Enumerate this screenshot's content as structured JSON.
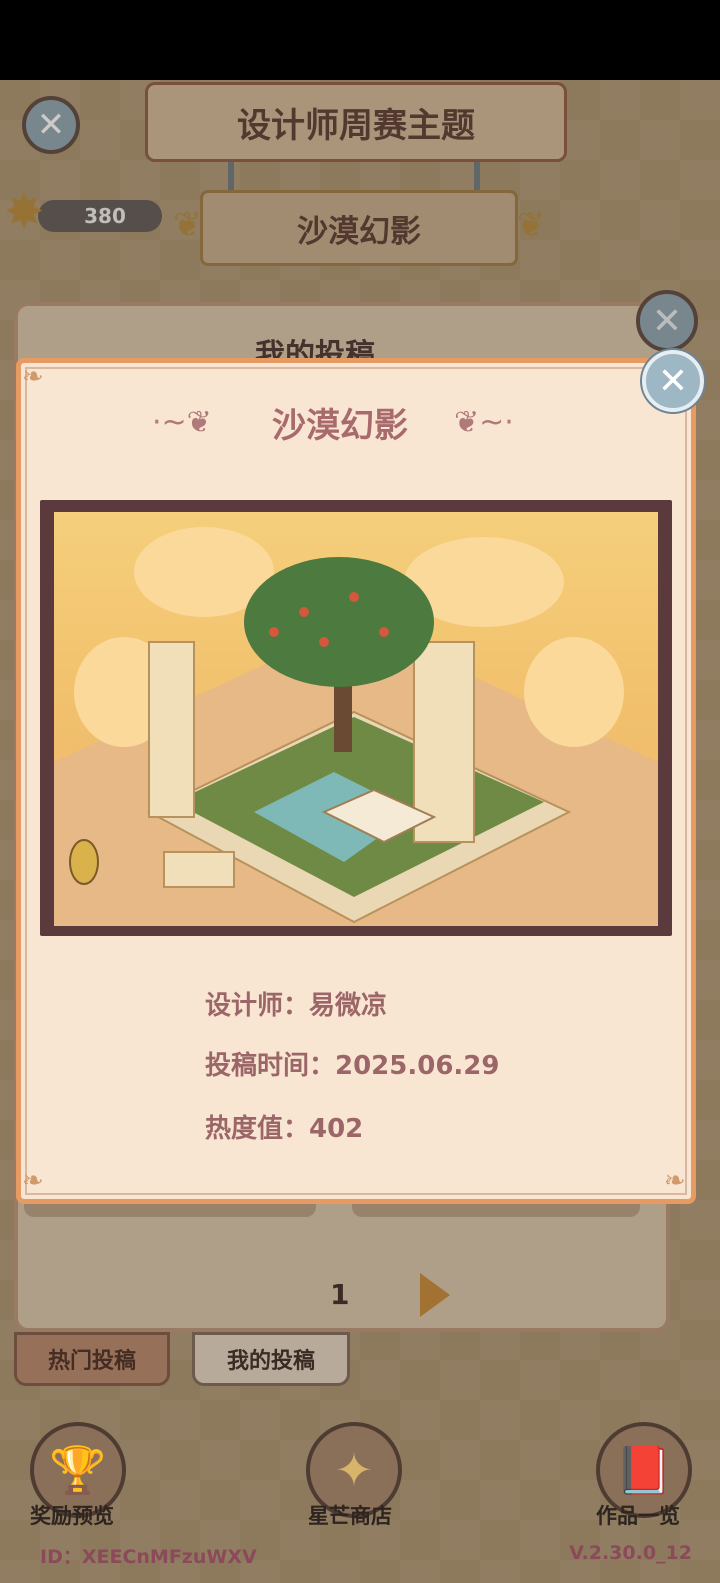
{
  "header": {
    "title": "设计师周赛主题",
    "theme_name": "沙漠幻影",
    "star_count": "380"
  },
  "back_panel": {
    "title": "我的投稿",
    "page_number": "1"
  },
  "tabs": [
    {
      "label": "热门投稿"
    },
    {
      "label": "我的投稿"
    }
  ],
  "bottom_nav": [
    {
      "label": "奖励预览",
      "icon": "trophy-icon"
    },
    {
      "label": "星芒商店",
      "icon": "star-icon"
    },
    {
      "label": "作品一览",
      "icon": "book-icon"
    }
  ],
  "footer": {
    "id_text": "ID：XEECnMFzuWXV",
    "version": "V.2.30.0_12"
  },
  "modal": {
    "title": "沙漠幻影",
    "designer": "设计师：易微凉",
    "submit_time": "投稿时间：2025.06.29",
    "heat": "热度值：402"
  },
  "colors": {
    "modal_border": "#e79b63",
    "modal_bg": "#f8e6d3",
    "title_text": "#a96a6e",
    "info_text": "#9c6668"
  }
}
